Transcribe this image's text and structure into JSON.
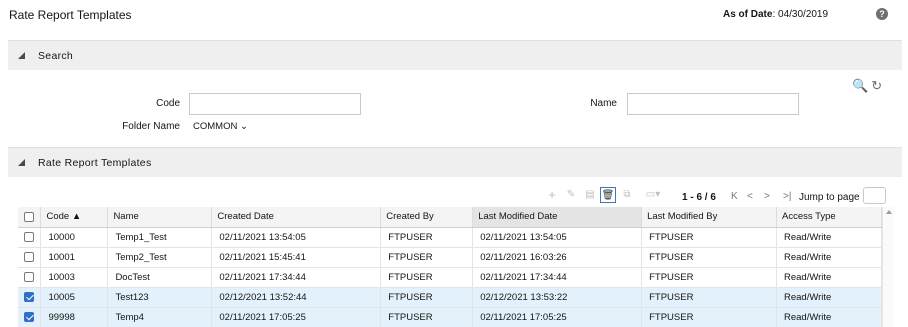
{
  "header": {
    "title": "Rate Report Templates",
    "asof_label": "As of Date",
    "asof_value": ": 04/30/2019",
    "help_glyph": "?"
  },
  "search": {
    "section_label": "Search",
    "code_label": "Code",
    "code_value": "",
    "name_label": "Name",
    "name_value": "",
    "folder_label": "Folder Name",
    "folder_value": "COMMON",
    "search_icon_glyph": "🔍",
    "reset_icon_glyph": "↻"
  },
  "grid_section": {
    "label": "Rate Report Templates"
  },
  "toolbar": {
    "add_glyph": "+",
    "edit_glyph": "✎",
    "view_glyph": "▤",
    "delete_glyph": "🗑",
    "copy_glyph": "⧉",
    "more_glyph": "▾",
    "pager_text": "1 - 6 / 6",
    "first_glyph": "K",
    "prev_glyph": "<",
    "next_glyph": ">",
    "last_glyph": ">|",
    "jump_label": "Jump to page"
  },
  "table": {
    "columns": [
      "Code ▲",
      "Name",
      "Created Date",
      "Created By",
      "Last Modified Date",
      "Last Modified By",
      "Access Type"
    ],
    "rows": [
      {
        "checked": false,
        "cells": [
          "10000",
          "Temp1_Test",
          "02/11/2021 13:54:05",
          "FTPUSER",
          "02/11/2021 13:54:05",
          "FTPUSER",
          "Read/Write"
        ]
      },
      {
        "checked": false,
        "cells": [
          "10001",
          "Temp2_Test",
          "02/11/2021 15:45:41",
          "FTPUSER",
          "02/11/2021 16:03:26",
          "FTPUSER",
          "Read/Write"
        ]
      },
      {
        "checked": false,
        "cells": [
          "10003",
          "DocTest",
          "02/11/2021 17:34:44",
          "FTPUSER",
          "02/11/2021 17:34:44",
          "FTPUSER",
          "Read/Write"
        ]
      },
      {
        "checked": true,
        "cells": [
          "10005",
          "Test123",
          "02/12/2021 13:52:44",
          "FTPUSER",
          "02/12/2021 13:53:22",
          "FTPUSER",
          "Read/Write"
        ]
      },
      {
        "checked": true,
        "cells": [
          "99998",
          "Temp4",
          "02/11/2021 17:05:25",
          "FTPUSER",
          "02/11/2021 17:05:25",
          "FTPUSER",
          "Read/Write"
        ]
      }
    ]
  },
  "colors": {
    "selected_row": "#e2f1fb",
    "checkbox_blue": "#2f6fc6",
    "section_bar": "#efefef"
  }
}
